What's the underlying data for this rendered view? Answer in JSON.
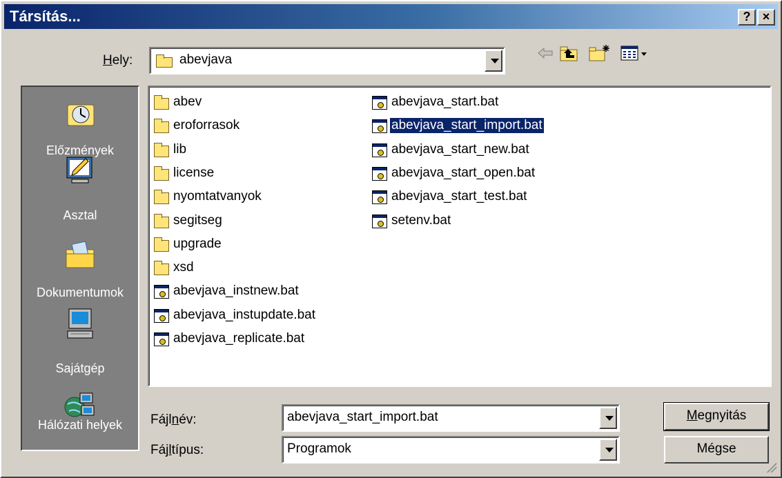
{
  "window": {
    "title": "Társítás...",
    "help_label": "?",
    "close_label": "×"
  },
  "location": {
    "label_prefix": "",
    "label_accel": "H",
    "label_rest": "ely:",
    "value": "abevjava"
  },
  "toolbar": [
    "back-arrow-icon",
    "up-one-level-icon",
    "new-folder-icon",
    "view-menu-icon"
  ],
  "places": [
    {
      "label": "Előzmények",
      "icon": "history-icon"
    },
    {
      "label": "Asztal",
      "icon": "desktop-icon"
    },
    {
      "label": "Dokumentumok",
      "icon": "documents-icon"
    },
    {
      "label": "Sajátgép",
      "icon": "my-computer-icon"
    },
    {
      "label": "Hálózati helyek",
      "icon": "network-places-icon"
    }
  ],
  "files": {
    "column1": [
      {
        "name": "abev",
        "type": "folder"
      },
      {
        "name": "eroforrasok",
        "type": "folder"
      },
      {
        "name": "lib",
        "type": "folder"
      },
      {
        "name": "license",
        "type": "folder"
      },
      {
        "name": "nyomtatvanyok",
        "type": "folder"
      },
      {
        "name": "segitseg",
        "type": "folder"
      },
      {
        "name": "upgrade",
        "type": "folder"
      },
      {
        "name": "xsd",
        "type": "folder"
      },
      {
        "name": "abevjava_instnew.bat",
        "type": "bat"
      },
      {
        "name": "abevjava_instupdate.bat",
        "type": "bat"
      },
      {
        "name": "abevjava_replicate.bat",
        "type": "bat"
      }
    ],
    "column2": [
      {
        "name": "abevjava_start.bat",
        "type": "bat"
      },
      {
        "name": "abevjava_start_import.bat",
        "type": "bat",
        "selected": true
      },
      {
        "name": "abevjava_start_new.bat",
        "type": "bat"
      },
      {
        "name": "abevjava_start_open.bat",
        "type": "bat"
      },
      {
        "name": "abevjava_start_test.bat",
        "type": "bat"
      },
      {
        "name": "setenv.bat",
        "type": "bat"
      }
    ]
  },
  "filename": {
    "label_prefix": "Fájl",
    "label_accel": "n",
    "label_rest": "év:",
    "value": "abevjava_start_import.bat"
  },
  "filetype": {
    "label_prefix": "Fáj",
    "label_accel": "l",
    "label_rest": "típus:",
    "value": "Programok"
  },
  "buttons": {
    "open_accel": "M",
    "open_rest": "egnyitás",
    "cancel": "Mégse"
  },
  "colors": {
    "title_start": "#0a246a",
    "title_end": "#a6caf0",
    "face": "#d4d0c8",
    "places_bg": "#808080",
    "selection": "#0a246a"
  }
}
